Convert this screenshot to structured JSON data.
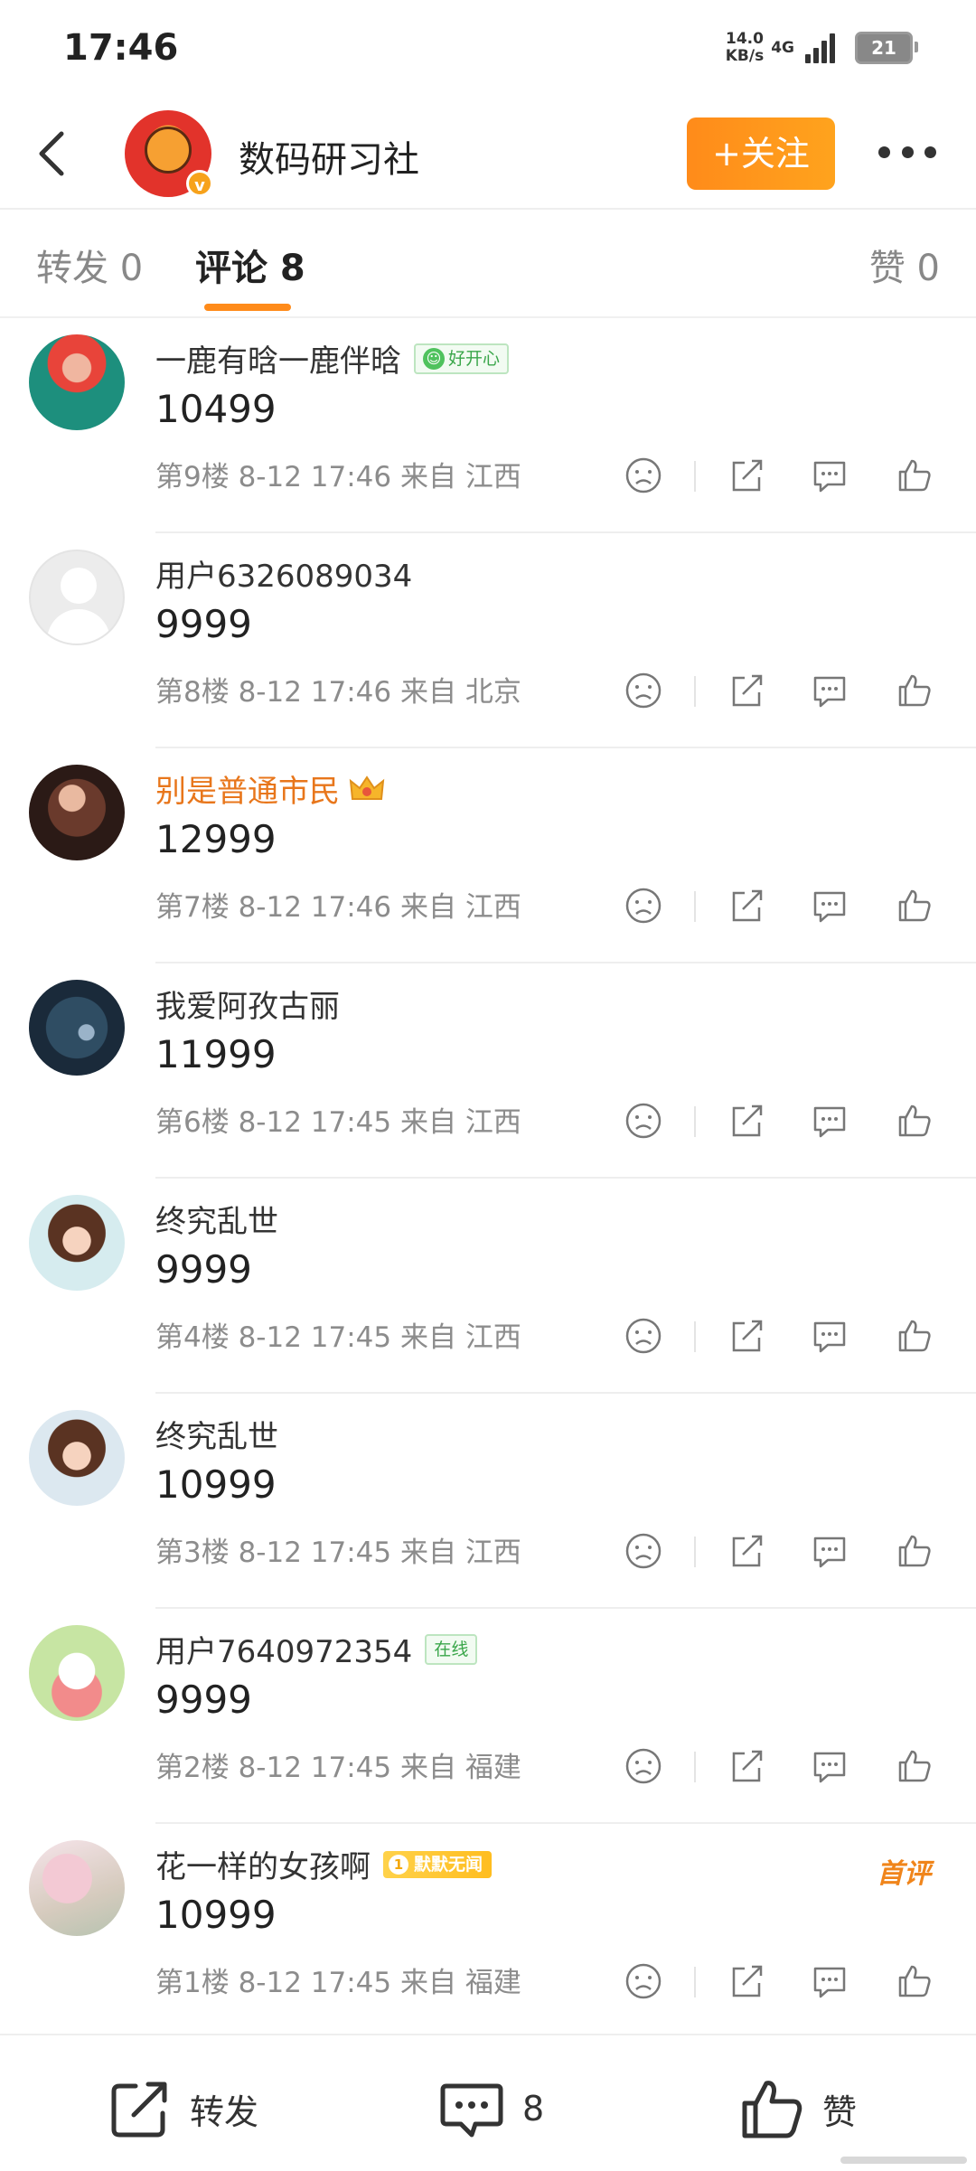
{
  "status_bar": {
    "time": "17:46",
    "net_speed": "14.0",
    "net_unit": "KB/s",
    "net_type": "4G",
    "battery": "21"
  },
  "header": {
    "title": "数码研习社",
    "follow_label": "+关注",
    "verified": "v"
  },
  "tabs": {
    "repost": "转发 0",
    "comments": "评论 8",
    "likes": "赞 0"
  },
  "comments": [
    {
      "name": "一鹿有晗一鹿伴晗",
      "tag": "好开心",
      "text": "10499",
      "meta": "第9楼 8-12 17:46 来自 江西"
    },
    {
      "name": "用户6326089034",
      "text": "9999",
      "meta": "第8楼 8-12 17:46 来自 北京"
    },
    {
      "name": "别是普通市民",
      "text": "12999",
      "meta": "第7楼 8-12 17:46 来自 江西"
    },
    {
      "name": "我爱阿孜古丽",
      "text": "11999",
      "meta": "第6楼 8-12 17:45 来自 江西"
    },
    {
      "name": "终究乱世",
      "text": "9999",
      "meta": "第4楼 8-12 17:45 来自 江西"
    },
    {
      "name": "终究乱世",
      "text": "10999",
      "meta": "第3楼 8-12 17:45 来自 江西"
    },
    {
      "name": "用户7640972354",
      "tag": "在线",
      "text": "9999",
      "meta": "第2楼 8-12 17:45 来自 福建"
    },
    {
      "name": "花一样的女孩啊",
      "tag": "默默无闻",
      "tag_level": "1",
      "badge": "首评",
      "text": "10999",
      "meta": "第1楼 8-12 17:45 来自 福建"
    }
  ],
  "bottom_bar": {
    "repost": "转发",
    "comment_count": "8",
    "like": "赞"
  },
  "colors": {
    "accent": "#ff8b1a",
    "text": "#333333",
    "meta": "#8c8c8c"
  },
  "icons": [
    "back-arrow-icon",
    "more-icon",
    "dislike-icon",
    "share-icon",
    "reply-icon",
    "like-icon",
    "repost-icon",
    "comment-icon",
    "thumbs-up-icon"
  ]
}
